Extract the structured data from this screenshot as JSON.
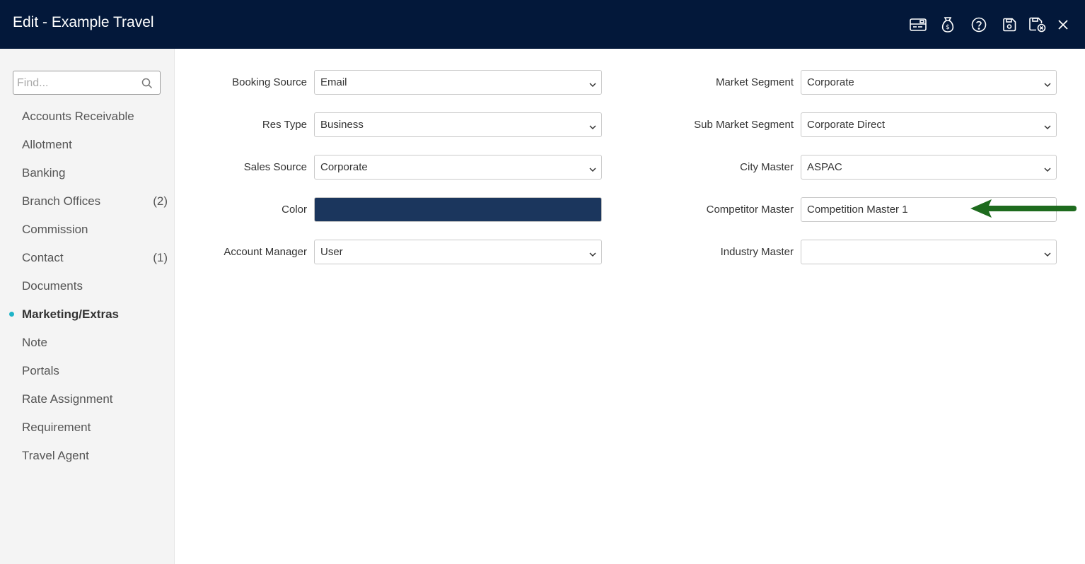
{
  "header": {
    "title": "Edit - Example Travel",
    "icons": [
      "card-icon",
      "money-bag-icon",
      "help-icon",
      "save-icon",
      "save-close-icon",
      "close-icon"
    ]
  },
  "sidebar": {
    "search_placeholder": "Find...",
    "items": [
      {
        "label": "Accounts Receivable",
        "count": ""
      },
      {
        "label": "Allotment",
        "count": ""
      },
      {
        "label": "Banking",
        "count": ""
      },
      {
        "label": "Branch Offices",
        "count": "(2)"
      },
      {
        "label": "Commission",
        "count": ""
      },
      {
        "label": "Contact",
        "count": "(1)"
      },
      {
        "label": "Documents",
        "count": ""
      },
      {
        "label": "Marketing/Extras",
        "count": "",
        "active": true
      },
      {
        "label": "Note",
        "count": ""
      },
      {
        "label": "Portals",
        "count": ""
      },
      {
        "label": "Rate Assignment",
        "count": ""
      },
      {
        "label": "Requirement",
        "count": ""
      },
      {
        "label": "Travel Agent",
        "count": ""
      }
    ]
  },
  "form": {
    "left": [
      {
        "label": "Booking Source",
        "value": "Email"
      },
      {
        "label": "Res Type",
        "value": "Business"
      },
      {
        "label": "Sales Source",
        "value": "Corporate"
      },
      {
        "label": "Color",
        "value": ""
      },
      {
        "label": "Account Manager",
        "value": "User"
      }
    ],
    "right": [
      {
        "label": "Market Segment",
        "value": "Corporate"
      },
      {
        "label": "Sub Market Segment",
        "value": "Corporate Direct"
      },
      {
        "label": "City Master",
        "value": "ASPAC"
      },
      {
        "label": "Competitor Master",
        "value": "Competition Master 1"
      },
      {
        "label": "Industry Master",
        "value": ""
      }
    ],
    "color_value": "#1b365d"
  },
  "colors": {
    "header_bg": "#03183a",
    "active_dot": "#1fb4c8",
    "annotation_arrow": "#1e6b1e"
  }
}
